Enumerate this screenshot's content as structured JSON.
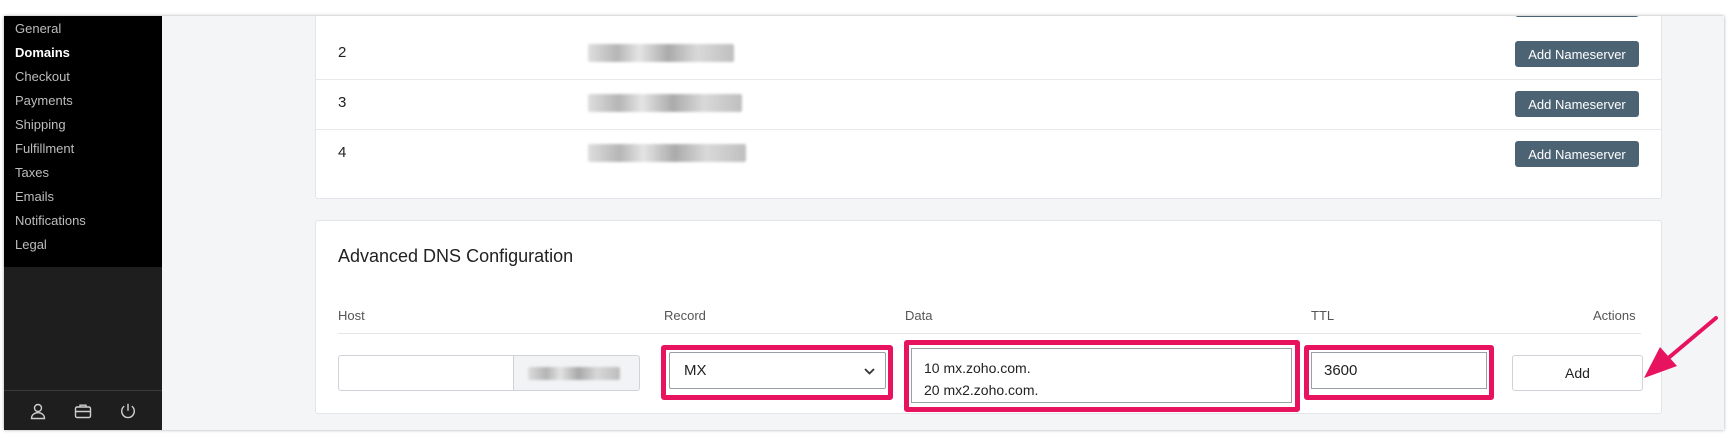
{
  "sidebar": {
    "items": [
      {
        "label": "General"
      },
      {
        "label": "Domains"
      },
      {
        "label": "Checkout"
      },
      {
        "label": "Payments"
      },
      {
        "label": "Shipping"
      },
      {
        "label": "Fulfillment"
      },
      {
        "label": "Taxes"
      },
      {
        "label": "Emails"
      },
      {
        "label": "Notifications"
      },
      {
        "label": "Legal"
      }
    ],
    "active_item": "Domains",
    "footer_icons": [
      "user-icon",
      "briefcase-icon",
      "power-icon"
    ]
  },
  "nameservers": {
    "rows": [
      {
        "number": "2",
        "button_label": "Add Nameserver"
      },
      {
        "number": "3",
        "button_label": "Add Nameserver"
      },
      {
        "number": "4",
        "button_label": "Add Nameserver"
      }
    ]
  },
  "dns": {
    "title": "Advanced DNS Configuration",
    "columns": {
      "host": "Host",
      "record": "Record",
      "data": "Data",
      "ttl": "TTL",
      "actions": "Actions"
    },
    "row": {
      "host_value": "",
      "record_value": "MX",
      "data_value": "10 mx.zoho.com.\n20 mx2.zoho.com.",
      "ttl_value": "3600",
      "add_label": "Add"
    }
  },
  "colors": {
    "highlight": "#e8135f",
    "nameserver_button": "#4c6374",
    "sidebar_bg": "#000000"
  }
}
